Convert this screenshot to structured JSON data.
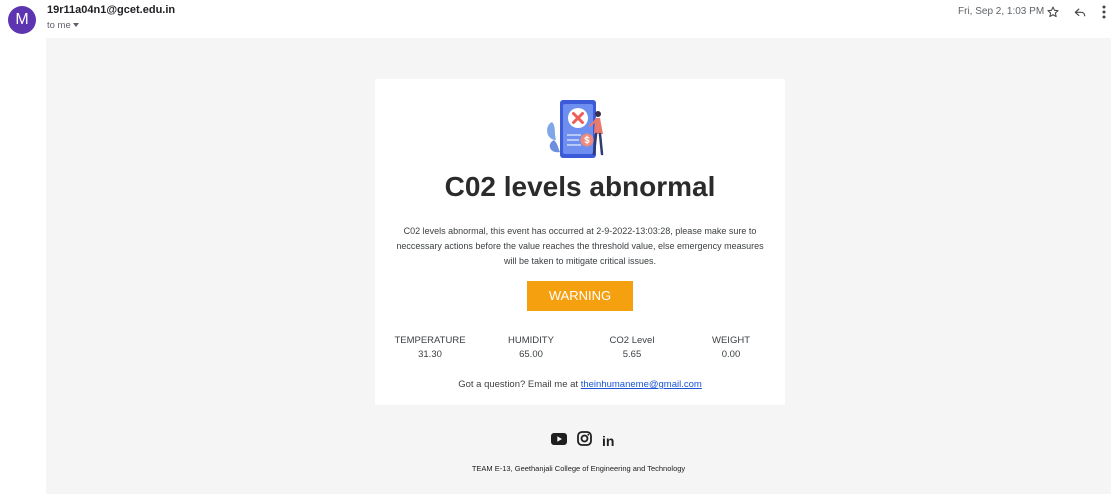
{
  "header": {
    "avatar_letter": "M",
    "sender": "19r11a04n1@gcet.edu.in",
    "recipient": "to me",
    "date": "Fri, Sep 2, 1:03 PM",
    "icons": [
      "star-icon",
      "reply-icon",
      "more-icon"
    ]
  },
  "email": {
    "title": "C02 levels abnormal",
    "description": "C02 levels abnormal, this event has occurred at 2-9-2022-13:03:28, please make sure to neccessary actions before the value reaches the threshold value, else emergency measures will be taken to mitigate critical issues.",
    "button_label": "WARNING",
    "button_color": "#f5a00f",
    "metrics": [
      {
        "label": "TEMPERATURE",
        "value": "31.30"
      },
      {
        "label": "HUMIDITY",
        "value": "65.00"
      },
      {
        "label": "CO2 Level",
        "value": "5.65"
      },
      {
        "label": "WEIGHT",
        "value": "0.00"
      }
    ],
    "contact_prefix": "Got a question? Email me at ",
    "contact_email": "theinhumaneme@gmail.com"
  },
  "footer": {
    "social_icons": [
      "youtube-icon",
      "instagram-icon",
      "linkedin-icon"
    ],
    "linkedin_text": "in",
    "text": "TEAM E-13, Geethanjali College of Engineering and Technology"
  }
}
